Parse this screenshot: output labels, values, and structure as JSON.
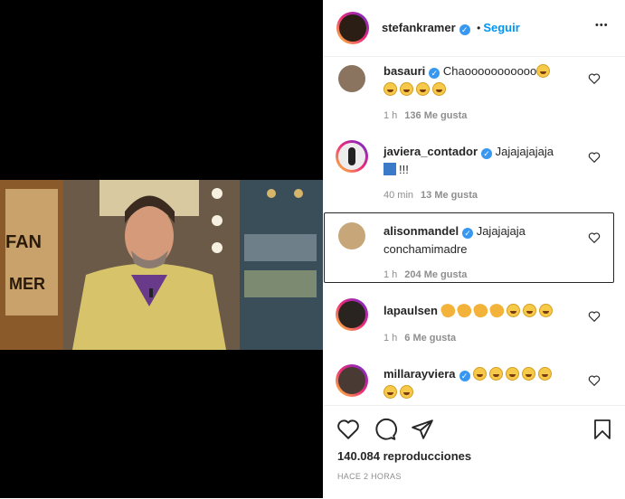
{
  "post": {
    "username": "stefankramer",
    "follow_label": "Seguir",
    "more_label": "•••",
    "views": "140.084 reproducciones",
    "timestamp": "HACE 2 HORAS"
  },
  "video": {
    "poster_text_1": "FAN",
    "poster_text_2": "MER"
  },
  "comments": [
    {
      "user": "basauri",
      "text": "Chaooooooooooo",
      "line2_emoji_count": 4,
      "time": "1 h",
      "likes": "136 Me gusta"
    },
    {
      "user": "javiera_contador",
      "text": "Jajajajajaja",
      "line2": "!!!",
      "time": "40 min",
      "likes": "13 Me gusta"
    },
    {
      "user": "alisonmandel",
      "text": "Jajajajaja",
      "line2": "conchamimadre",
      "time": "1 h",
      "likes": "204 Me gusta"
    },
    {
      "user": "lapaulsen",
      "text": "",
      "time": "1 h",
      "likes": "6 Me gusta"
    },
    {
      "user": "millarayviera",
      "text": "",
      "time": "",
      "likes": ""
    }
  ],
  "colors": {
    "accent": "#0095f6",
    "verified": "#3897f0",
    "text": "#262626",
    "muted": "#8e8e8e"
  }
}
